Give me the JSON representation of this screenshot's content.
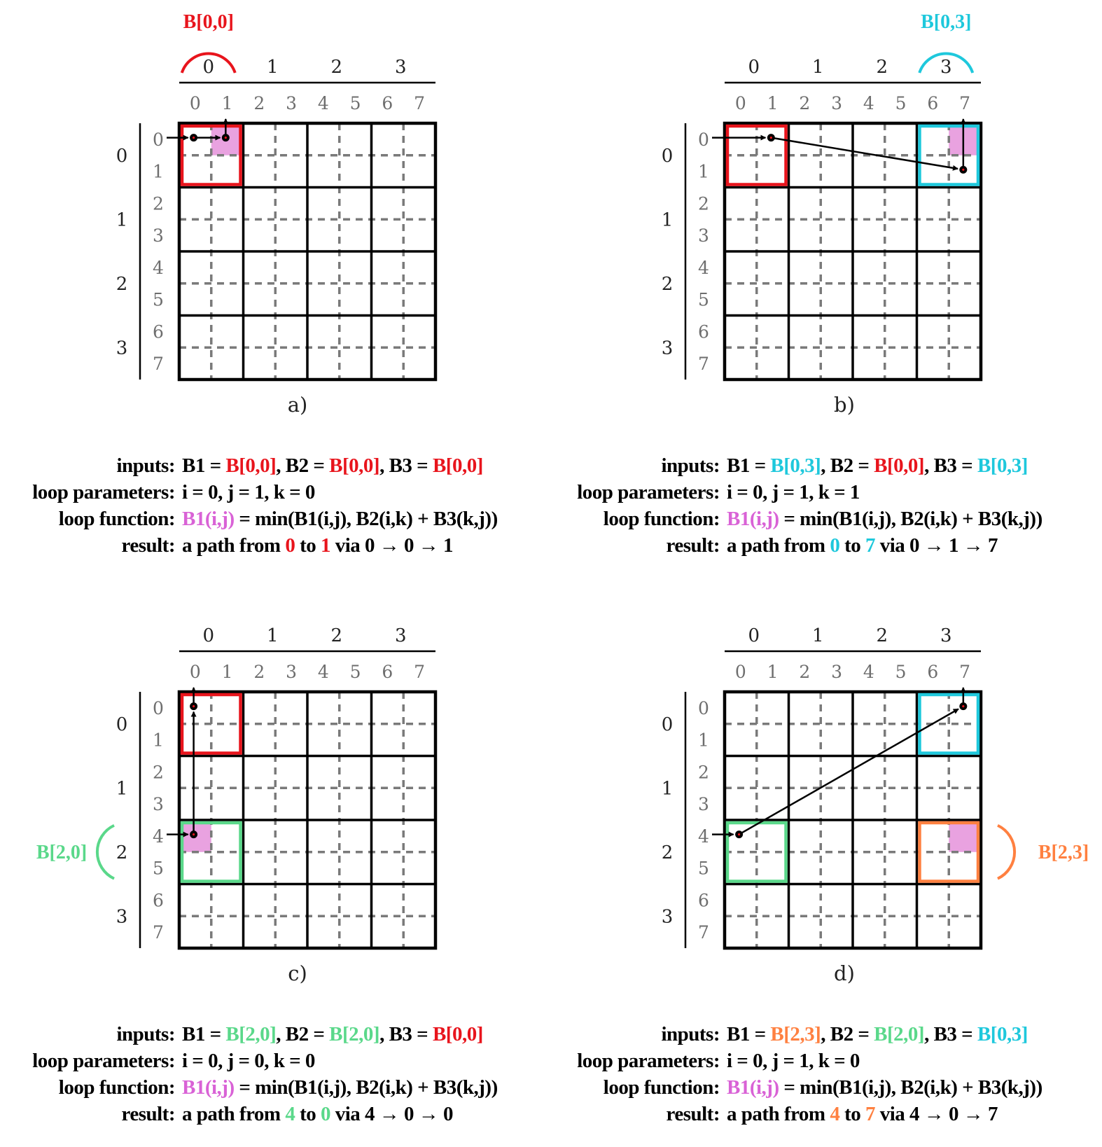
{
  "colors": {
    "red": "#e8141c",
    "cyan": "#1ec8dc",
    "green": "#5ad88a",
    "orange": "#ff8040",
    "pink": "#e9a2e0",
    "magenta": "#d962d6",
    "grid": "#000000",
    "dashed": "#7a7a7a",
    "sub_label": "#6e6e6e",
    "block_label": "#222222"
  },
  "axis": {
    "block_labels": [
      "0",
      "1",
      "2",
      "3"
    ],
    "sub_labels": [
      "0",
      "1",
      "2",
      "3",
      "4",
      "5",
      "6",
      "7"
    ]
  },
  "panels": [
    {
      "id": "a",
      "caption": "a)",
      "highlights": [
        {
          "label": "B[0,0]",
          "block": [
            0,
            0
          ],
          "color": "red",
          "arc": "top"
        }
      ],
      "pink_cell": [
        0,
        1
      ],
      "path_nodes": [
        [
          0,
          0
        ],
        [
          0,
          1
        ]
      ],
      "entry_row": 0,
      "exit_col": 1,
      "info": {
        "labels": [
          "inputs:",
          "loop parameters:",
          "loop function:",
          "result:"
        ],
        "inputs": [
          {
            "text": "B1 = ",
            "color": null
          },
          {
            "text": "B[0,0]",
            "color": "red"
          },
          {
            "text": ", B2 = ",
            "color": null
          },
          {
            "text": "B[0,0]",
            "color": "red"
          },
          {
            "text": ", B3 = ",
            "color": null
          },
          {
            "text": "B[0,0]",
            "color": "red"
          }
        ],
        "loop_parameters": "i = 0, j = 1, k = 0",
        "loop_function": [
          {
            "text": "B1(i,j)",
            "color": "magenta"
          },
          {
            "text": " = min(B1(i,j), B2(i,k) + B3(k,j))",
            "color": null
          }
        ],
        "result": [
          {
            "text": "a path from ",
            "color": null
          },
          {
            "text": "0",
            "color": "red"
          },
          {
            "text": " to ",
            "color": null
          },
          {
            "text": "1",
            "color": "red"
          },
          {
            "text": " via 0 → 0 → 1",
            "color": null
          }
        ]
      }
    },
    {
      "id": "b",
      "caption": "b)",
      "highlights": [
        {
          "label": "",
          "block": [
            0,
            0
          ],
          "color": "red",
          "arc": "none"
        },
        {
          "label": "B[0,3]",
          "block": [
            0,
            3
          ],
          "color": "cyan",
          "arc": "top"
        }
      ],
      "pink_cell": [
        0,
        7
      ],
      "path_nodes": [
        [
          0,
          1
        ],
        [
          1,
          7
        ]
      ],
      "entry_row": 0,
      "exit_col": 7,
      "info": {
        "labels": [
          "inputs:",
          "loop parameters:",
          "loop function:",
          "result:"
        ],
        "inputs": [
          {
            "text": "B1 = ",
            "color": null
          },
          {
            "text": "B[0,3]",
            "color": "cyan"
          },
          {
            "text": ", B2 = ",
            "color": null
          },
          {
            "text": "B[0,0]",
            "color": "red"
          },
          {
            "text": ", B3 = ",
            "color": null
          },
          {
            "text": "B[0,3]",
            "color": "cyan"
          }
        ],
        "loop_parameters": "i = 0, j = 1, k = 1",
        "loop_function": [
          {
            "text": "B1(i,j)",
            "color": "magenta"
          },
          {
            "text": " = min(B1(i,j), B2(i,k) + B3(k,j))",
            "color": null
          }
        ],
        "result": [
          {
            "text": "a path from ",
            "color": null
          },
          {
            "text": "0",
            "color": "cyan"
          },
          {
            "text": " to ",
            "color": null
          },
          {
            "text": "7",
            "color": "cyan"
          },
          {
            "text": " via 0 → 1 → 7",
            "color": null
          }
        ]
      }
    },
    {
      "id": "c",
      "caption": "c)",
      "highlights": [
        {
          "label": "",
          "block": [
            0,
            0
          ],
          "color": "red",
          "arc": "none"
        },
        {
          "label": "B[2,0]",
          "block": [
            2,
            0
          ],
          "color": "green",
          "arc": "left"
        }
      ],
      "pink_cell": [
        4,
        0
      ],
      "path_nodes": [
        [
          4,
          0
        ],
        [
          0,
          0
        ]
      ],
      "entry_row": 4,
      "exit_col": 0,
      "info": {
        "labels": [
          "inputs:",
          "loop parameters:",
          "loop function:",
          "result:"
        ],
        "inputs": [
          {
            "text": "B1 = ",
            "color": null
          },
          {
            "text": "B[2,0]",
            "color": "green"
          },
          {
            "text": ", B2 = ",
            "color": null
          },
          {
            "text": "B[2,0]",
            "color": "green"
          },
          {
            "text": ", B3 = ",
            "color": null
          },
          {
            "text": "B[0,0]",
            "color": "red"
          }
        ],
        "loop_parameters": "i = 0, j = 0, k = 0",
        "loop_function": [
          {
            "text": "B1(i,j)",
            "color": "magenta"
          },
          {
            "text": " = min(B1(i,j), B2(i,k) + B3(k,j))",
            "color": null
          }
        ],
        "result": [
          {
            "text": "a path from ",
            "color": null
          },
          {
            "text": "4",
            "color": "green"
          },
          {
            "text": " to ",
            "color": null
          },
          {
            "text": "0",
            "color": "green"
          },
          {
            "text": " via 4 → 0 → 0",
            "color": null
          }
        ]
      }
    },
    {
      "id": "d",
      "caption": "d)",
      "highlights": [
        {
          "label": "",
          "block": [
            0,
            3
          ],
          "color": "cyan",
          "arc": "none"
        },
        {
          "label": "",
          "block": [
            2,
            0
          ],
          "color": "green",
          "arc": "none"
        },
        {
          "label": "B[2,3]",
          "block": [
            2,
            3
          ],
          "color": "orange",
          "arc": "right"
        }
      ],
      "pink_cell": [
        4,
        7
      ],
      "path_nodes": [
        [
          4,
          0
        ],
        [
          0,
          7
        ]
      ],
      "entry_row": 4,
      "exit_col": 7,
      "info": {
        "labels": [
          "inputs:",
          "loop parameters:",
          "loop function:",
          "result:"
        ],
        "inputs": [
          {
            "text": "B1 = ",
            "color": null
          },
          {
            "text": "B[2,3]",
            "color": "orange"
          },
          {
            "text": ", B2 = ",
            "color": null
          },
          {
            "text": "B[2,0]",
            "color": "green"
          },
          {
            "text": ", B3 = ",
            "color": null
          },
          {
            "text": "B[0,3]",
            "color": "cyan"
          }
        ],
        "loop_parameters": "i = 0, j = 1, k = 0",
        "loop_function": [
          {
            "text": "B1(i,j)",
            "color": "magenta"
          },
          {
            "text": " = min(B1(i,j), B2(i,k) + B3(k,j))",
            "color": null
          }
        ],
        "result": [
          {
            "text": "a path from ",
            "color": null
          },
          {
            "text": "4",
            "color": "orange"
          },
          {
            "text": " to ",
            "color": null
          },
          {
            "text": "7",
            "color": "orange"
          },
          {
            "text": " via 4 → 0 → 7",
            "color": null
          }
        ]
      }
    }
  ]
}
